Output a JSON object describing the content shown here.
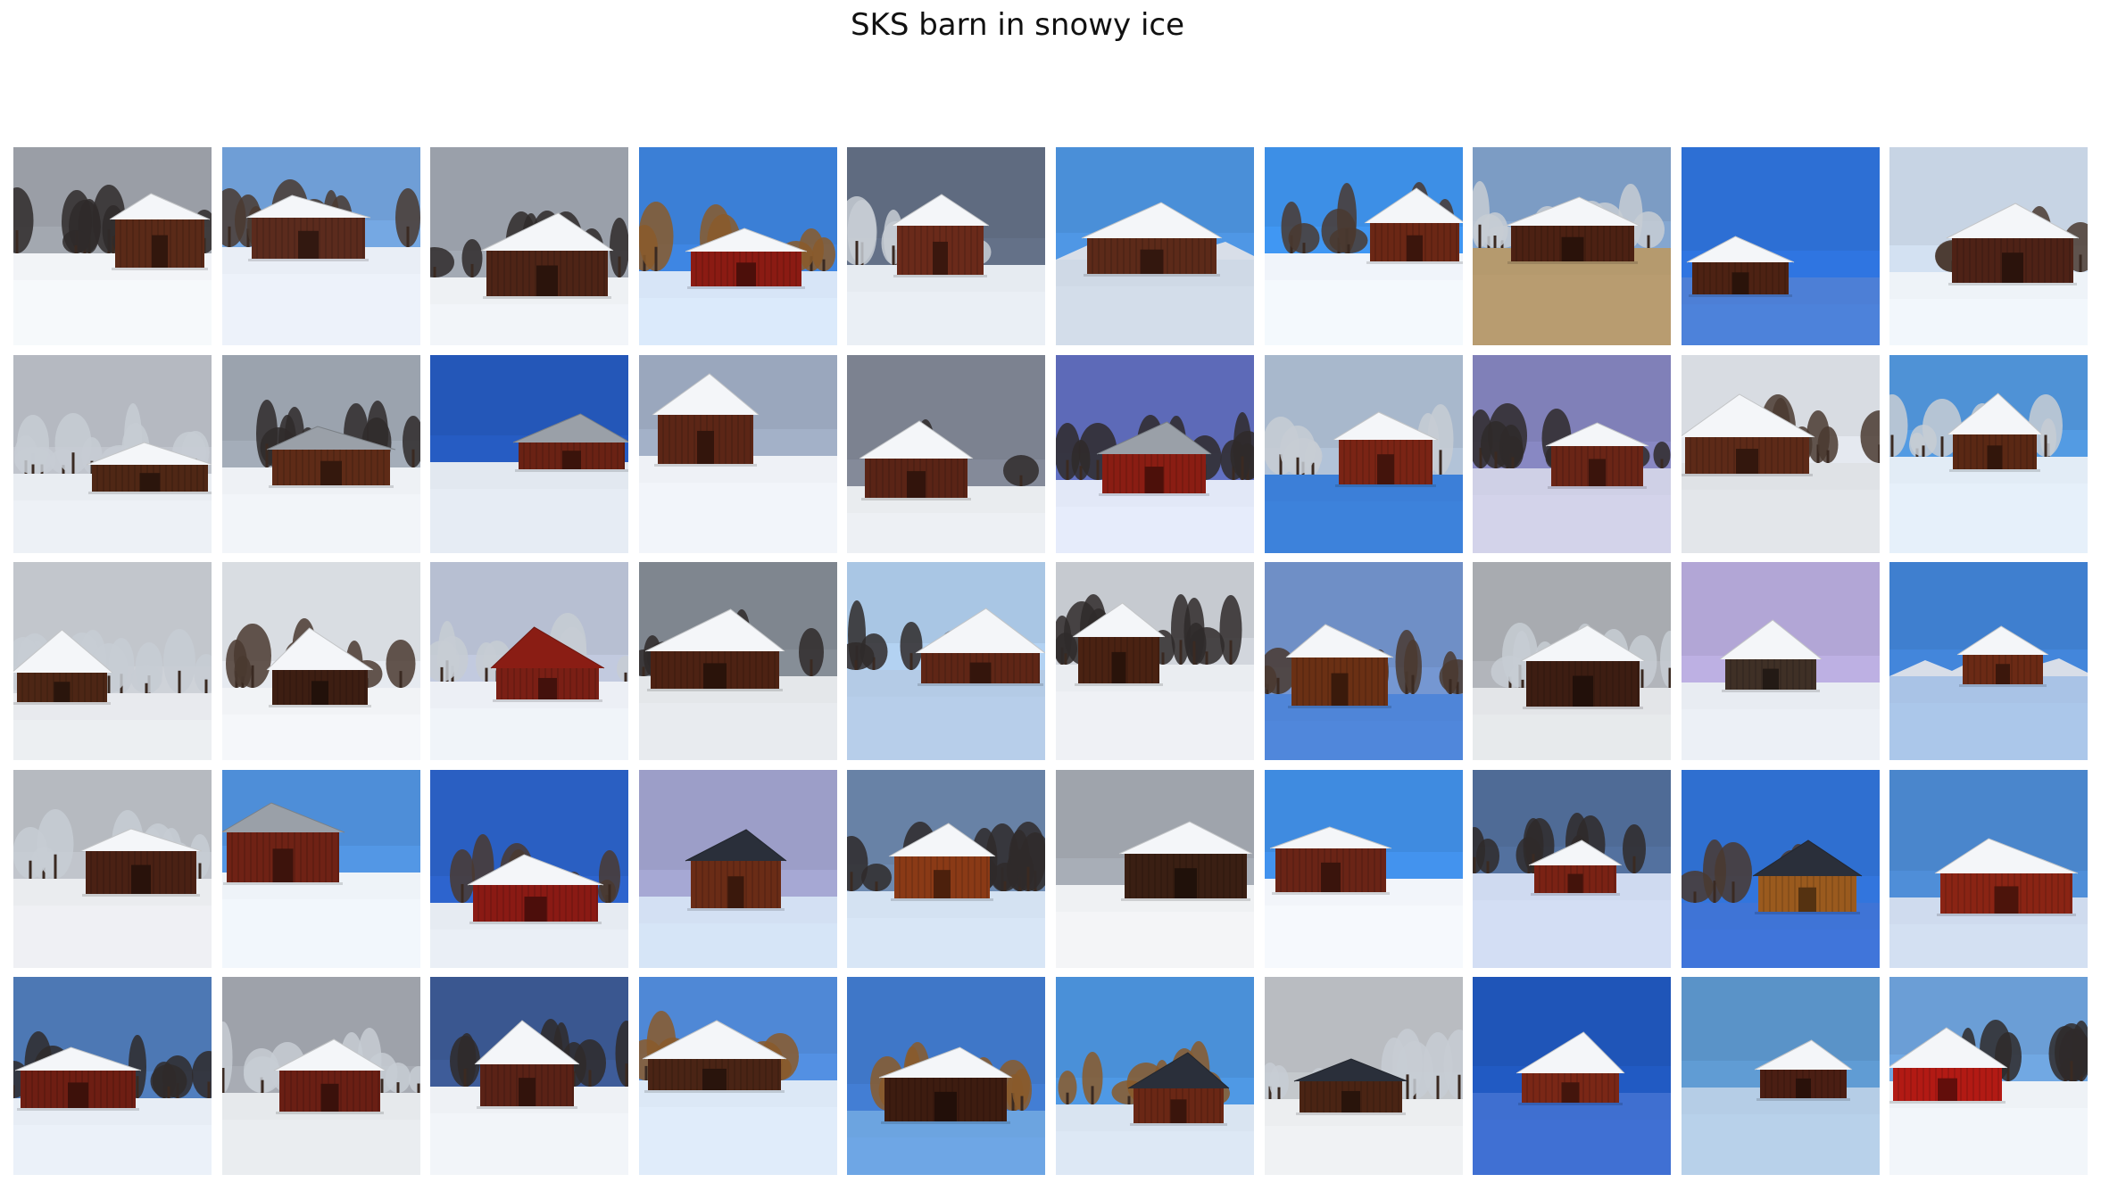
{
  "figure": {
    "title": "SKS barn in snowy ice"
  },
  "grid": {
    "rows": 5,
    "columns": 10,
    "images": [
      {
        "row": 1,
        "col": 1,
        "sky": "#9a9ea6",
        "snow": "#f2f4f7",
        "barn": "#5a2a18",
        "trees": "gray",
        "roof": "white"
      },
      {
        "row": 1,
        "col": 2,
        "sky": "#6f9ed6",
        "snow": "#e9eef6",
        "barn": "#5b2b1d",
        "trees": "bare",
        "roof": "white"
      },
      {
        "row": 1,
        "col": 3,
        "sky": "#9aa0aa",
        "snow": "#eef1f4",
        "barn": "#4e2416",
        "trees": "dark",
        "roof": "white"
      },
      {
        "row": 1,
        "col": 4,
        "sky": "#3b7fd6",
        "snow": "#d7e5f7",
        "barn": "#8b1b13",
        "trees": "autumn",
        "roof": "white"
      },
      {
        "row": 1,
        "col": 5,
        "sky": "#5f6b80",
        "snow": "#e6ebf1",
        "barn": "#6a2a1a",
        "trees": "snowy",
        "roof": "white"
      },
      {
        "row": 1,
        "col": 6,
        "sky": "#4a8fd8",
        "snow": "#cfd9e6",
        "barn": "#5c2a19",
        "trees": "mountains",
        "roof": "white"
      },
      {
        "row": 1,
        "col": 7,
        "sky": "#3d8fe6",
        "snow": "#f0f4fa",
        "barn": "#6b2715",
        "trees": "bare",
        "roof": "white"
      },
      {
        "row": 1,
        "col": 8,
        "sky": "#7c9cc4",
        "snow": "#b59a6e",
        "barn": "#4c2113",
        "trees": "snowy",
        "roof": "white"
      },
      {
        "row": 1,
        "col": 9,
        "sky": "#2d6fd4",
        "snow": "#4d7fd6",
        "barn": "#4d2213",
        "trees": "none",
        "roof": "white"
      },
      {
        "row": 1,
        "col": 10,
        "sky": "#c7d4e4",
        "snow": "#eef3f8",
        "barn": "#4e2216",
        "trees": "bare",
        "roof": "white"
      },
      {
        "row": 2,
        "col": 1,
        "sky": "#b5b9c1",
        "snow": "#e9edf2",
        "barn": "#4f2715",
        "trees": "snowy",
        "roof": "white"
      },
      {
        "row": 2,
        "col": 2,
        "sky": "#9ba3ae",
        "snow": "#eef1f5",
        "barn": "#5e2b17",
        "trees": "dark",
        "roof": "gray"
      },
      {
        "row": 2,
        "col": 3,
        "sky": "#2457b8",
        "snow": "#e2e8f0",
        "barn": "#6a2214",
        "trees": "none",
        "roof": "gray"
      },
      {
        "row": 2,
        "col": 4,
        "sky": "#9aa7bd",
        "snow": "#eef1f6",
        "barn": "#5c2616",
        "trees": "none",
        "roof": "white"
      },
      {
        "row": 2,
        "col": 5,
        "sky": "#7c8290",
        "snow": "#e9ecef",
        "barn": "#5a2416",
        "trees": "dark",
        "roof": "white"
      },
      {
        "row": 2,
        "col": 6,
        "sky": "#5d6ab8",
        "snow": "#e2e8f7",
        "barn": "#8a1d13",
        "trees": "dark",
        "roof": "gray"
      },
      {
        "row": 2,
        "col": 7,
        "sky": "#a8b8cc",
        "snow": "#3c7fd8",
        "barn": "#7a2415",
        "trees": "snowy",
        "roof": "white"
      },
      {
        "row": 2,
        "col": 8,
        "sky": "#8080b8",
        "snow": "#cfd0e6",
        "barn": "#6a2516",
        "trees": "dark",
        "roof": "white"
      },
      {
        "row": 2,
        "col": 9,
        "sky": "#d8dce2",
        "snow": "#dfe2e6",
        "barn": "#5d2a18",
        "trees": "bare",
        "roof": "white"
      },
      {
        "row": 2,
        "col": 10,
        "sky": "#4f92d6",
        "snow": "#e2ecf6",
        "barn": "#5a2814",
        "trees": "snowy",
        "roof": "white"
      },
      {
        "row": 3,
        "col": 1,
        "sky": "#c2c6cc",
        "snow": "#e8eaee",
        "barn": "#4d2615",
        "trees": "snowy",
        "roof": "white"
      },
      {
        "row": 3,
        "col": 2,
        "sky": "#d9dde2",
        "snow": "#f1f3f6",
        "barn": "#3d1e12",
        "trees": "bare",
        "roof": "white"
      },
      {
        "row": 3,
        "col": 3,
        "sky": "#b7bfd2",
        "snow": "#eceff5",
        "barn": "#7a1f15",
        "trees": "snowy",
        "roof": "red"
      },
      {
        "row": 3,
        "col": 4,
        "sky": "#7f868f",
        "snow": "#e4e7ea",
        "barn": "#4d2213",
        "trees": "dark",
        "roof": "white"
      },
      {
        "row": 3,
        "col": 5,
        "sky": "#a9c6e4",
        "snow": "#b4cbe6",
        "barn": "#5f2616",
        "trees": "dark",
        "roof": "white"
      },
      {
        "row": 3,
        "col": 6,
        "sky": "#c6cad0",
        "snow": "#eaedf1",
        "barn": "#4a2212",
        "trees": "dark",
        "roof": "white"
      },
      {
        "row": 3,
        "col": 7,
        "sky": "#6f8fc6",
        "snow": "#4f85d8",
        "barn": "#6a3014",
        "trees": "bare",
        "roof": "white"
      },
      {
        "row": 3,
        "col": 8,
        "sky": "#a8abb0",
        "snow": "#e3e5e8",
        "barn": "#3d1d12",
        "trees": "snowy",
        "roof": "white"
      },
      {
        "row": 3,
        "col": 9,
        "sky": "#b2a6d6",
        "snow": "#e8ecf2",
        "barn": "#3f3026",
        "trees": "none",
        "roof": "white"
      },
      {
        "row": 3,
        "col": 10,
        "sky": "#3f7fcf",
        "snow": "#a9c3e6",
        "barn": "#6b2a15",
        "trees": "mountains",
        "roof": "white"
      },
      {
        "row": 4,
        "col": 1,
        "sky": "#b6bac0",
        "snow": "#eaecef",
        "barn": "#4a2114",
        "trees": "snowy",
        "roof": "white"
      },
      {
        "row": 4,
        "col": 2,
        "sky": "#4e8ed8",
        "snow": "#eef3f8",
        "barn": "#6f2215",
        "trees": "none",
        "roof": "gray"
      },
      {
        "row": 4,
        "col": 3,
        "sky": "#2a5fc2",
        "snow": "#e6ebf2",
        "barn": "#8a1a14",
        "trees": "bare",
        "roof": "white"
      },
      {
        "row": 4,
        "col": 4,
        "sky": "#9c9ec8",
        "snow": "#d3e0f3",
        "barn": "#6a2c16",
        "trees": "none",
        "roof": "dark"
      },
      {
        "row": 4,
        "col": 5,
        "sky": "#6882a6",
        "snow": "#d4e2f2",
        "barn": "#8a3a16",
        "trees": "dark",
        "roof": "white"
      },
      {
        "row": 4,
        "col": 6,
        "sky": "#9fa4ac",
        "snow": "#eff1f3",
        "barn": "#3a1f13",
        "trees": "none",
        "roof": "white"
      },
      {
        "row": 4,
        "col": 7,
        "sky": "#3f8be0",
        "snow": "#f2f5fa",
        "barn": "#6a2416",
        "trees": "none",
        "roof": "white"
      },
      {
        "row": 4,
        "col": 8,
        "sky": "#4f6b96",
        "snow": "#cfdaf0",
        "barn": "#7a2214",
        "trees": "dark",
        "roof": "white"
      },
      {
        "row": 4,
        "col": 9,
        "sky": "#2f6fd0",
        "snow": "#3f74d6",
        "barn": "#9a5a1e",
        "trees": "bare",
        "roof": "dark"
      },
      {
        "row": 4,
        "col": 10,
        "sky": "#4a86cc",
        "snow": "#cfdbee",
        "barn": "#8a2414",
        "trees": "none",
        "roof": "white"
      },
      {
        "row": 5,
        "col": 1,
        "sky": "#4d78b4",
        "snow": "#e7edf5",
        "barn": "#6e1e13",
        "trees": "dark",
        "roof": "white"
      },
      {
        "row": 5,
        "col": 2,
        "sky": "#9ea2aa",
        "snow": "#e6e9ec",
        "barn": "#6a1f14",
        "trees": "snowy",
        "roof": "white"
      },
      {
        "row": 5,
        "col": 3,
        "sky": "#3a5790",
        "snow": "#eef1f5",
        "barn": "#5a2216",
        "trees": "dark",
        "roof": "white"
      },
      {
        "row": 5,
        "col": 4,
        "sky": "#4f88d6",
        "snow": "#dce8f6",
        "barn": "#4a2415",
        "trees": "autumn",
        "roof": "white"
      },
      {
        "row": 5,
        "col": 5,
        "sky": "#3f77c8",
        "snow": "#6ca4e0",
        "barn": "#3d1c10",
        "trees": "autumn",
        "roof": "white"
      },
      {
        "row": 5,
        "col": 6,
        "sky": "#4a90d8",
        "snow": "#d9e4f1",
        "barn": "#6a2715",
        "trees": "autumn",
        "roof": "dark"
      },
      {
        "row": 5,
        "col": 7,
        "sky": "#b9bcc1",
        "snow": "#eceef0",
        "barn": "#4a2414",
        "trees": "snowy",
        "roof": "dark"
      },
      {
        "row": 5,
        "col": 8,
        "sky": "#1f55b8",
        "snow": "#3f6fd0",
        "barn": "#7a2716",
        "trees": "none",
        "roof": "white"
      },
      {
        "row": 5,
        "col": 9,
        "sky": "#5a93c8",
        "snow": "#b5cde6",
        "barn": "#4a1e13",
        "trees": "none",
        "roof": "white"
      },
      {
        "row": 5,
        "col": 10,
        "sky": "#6b9ed6",
        "snow": "#eef2f6",
        "barn": "#b21a14",
        "trees": "dark",
        "roof": "white"
      }
    ]
  }
}
